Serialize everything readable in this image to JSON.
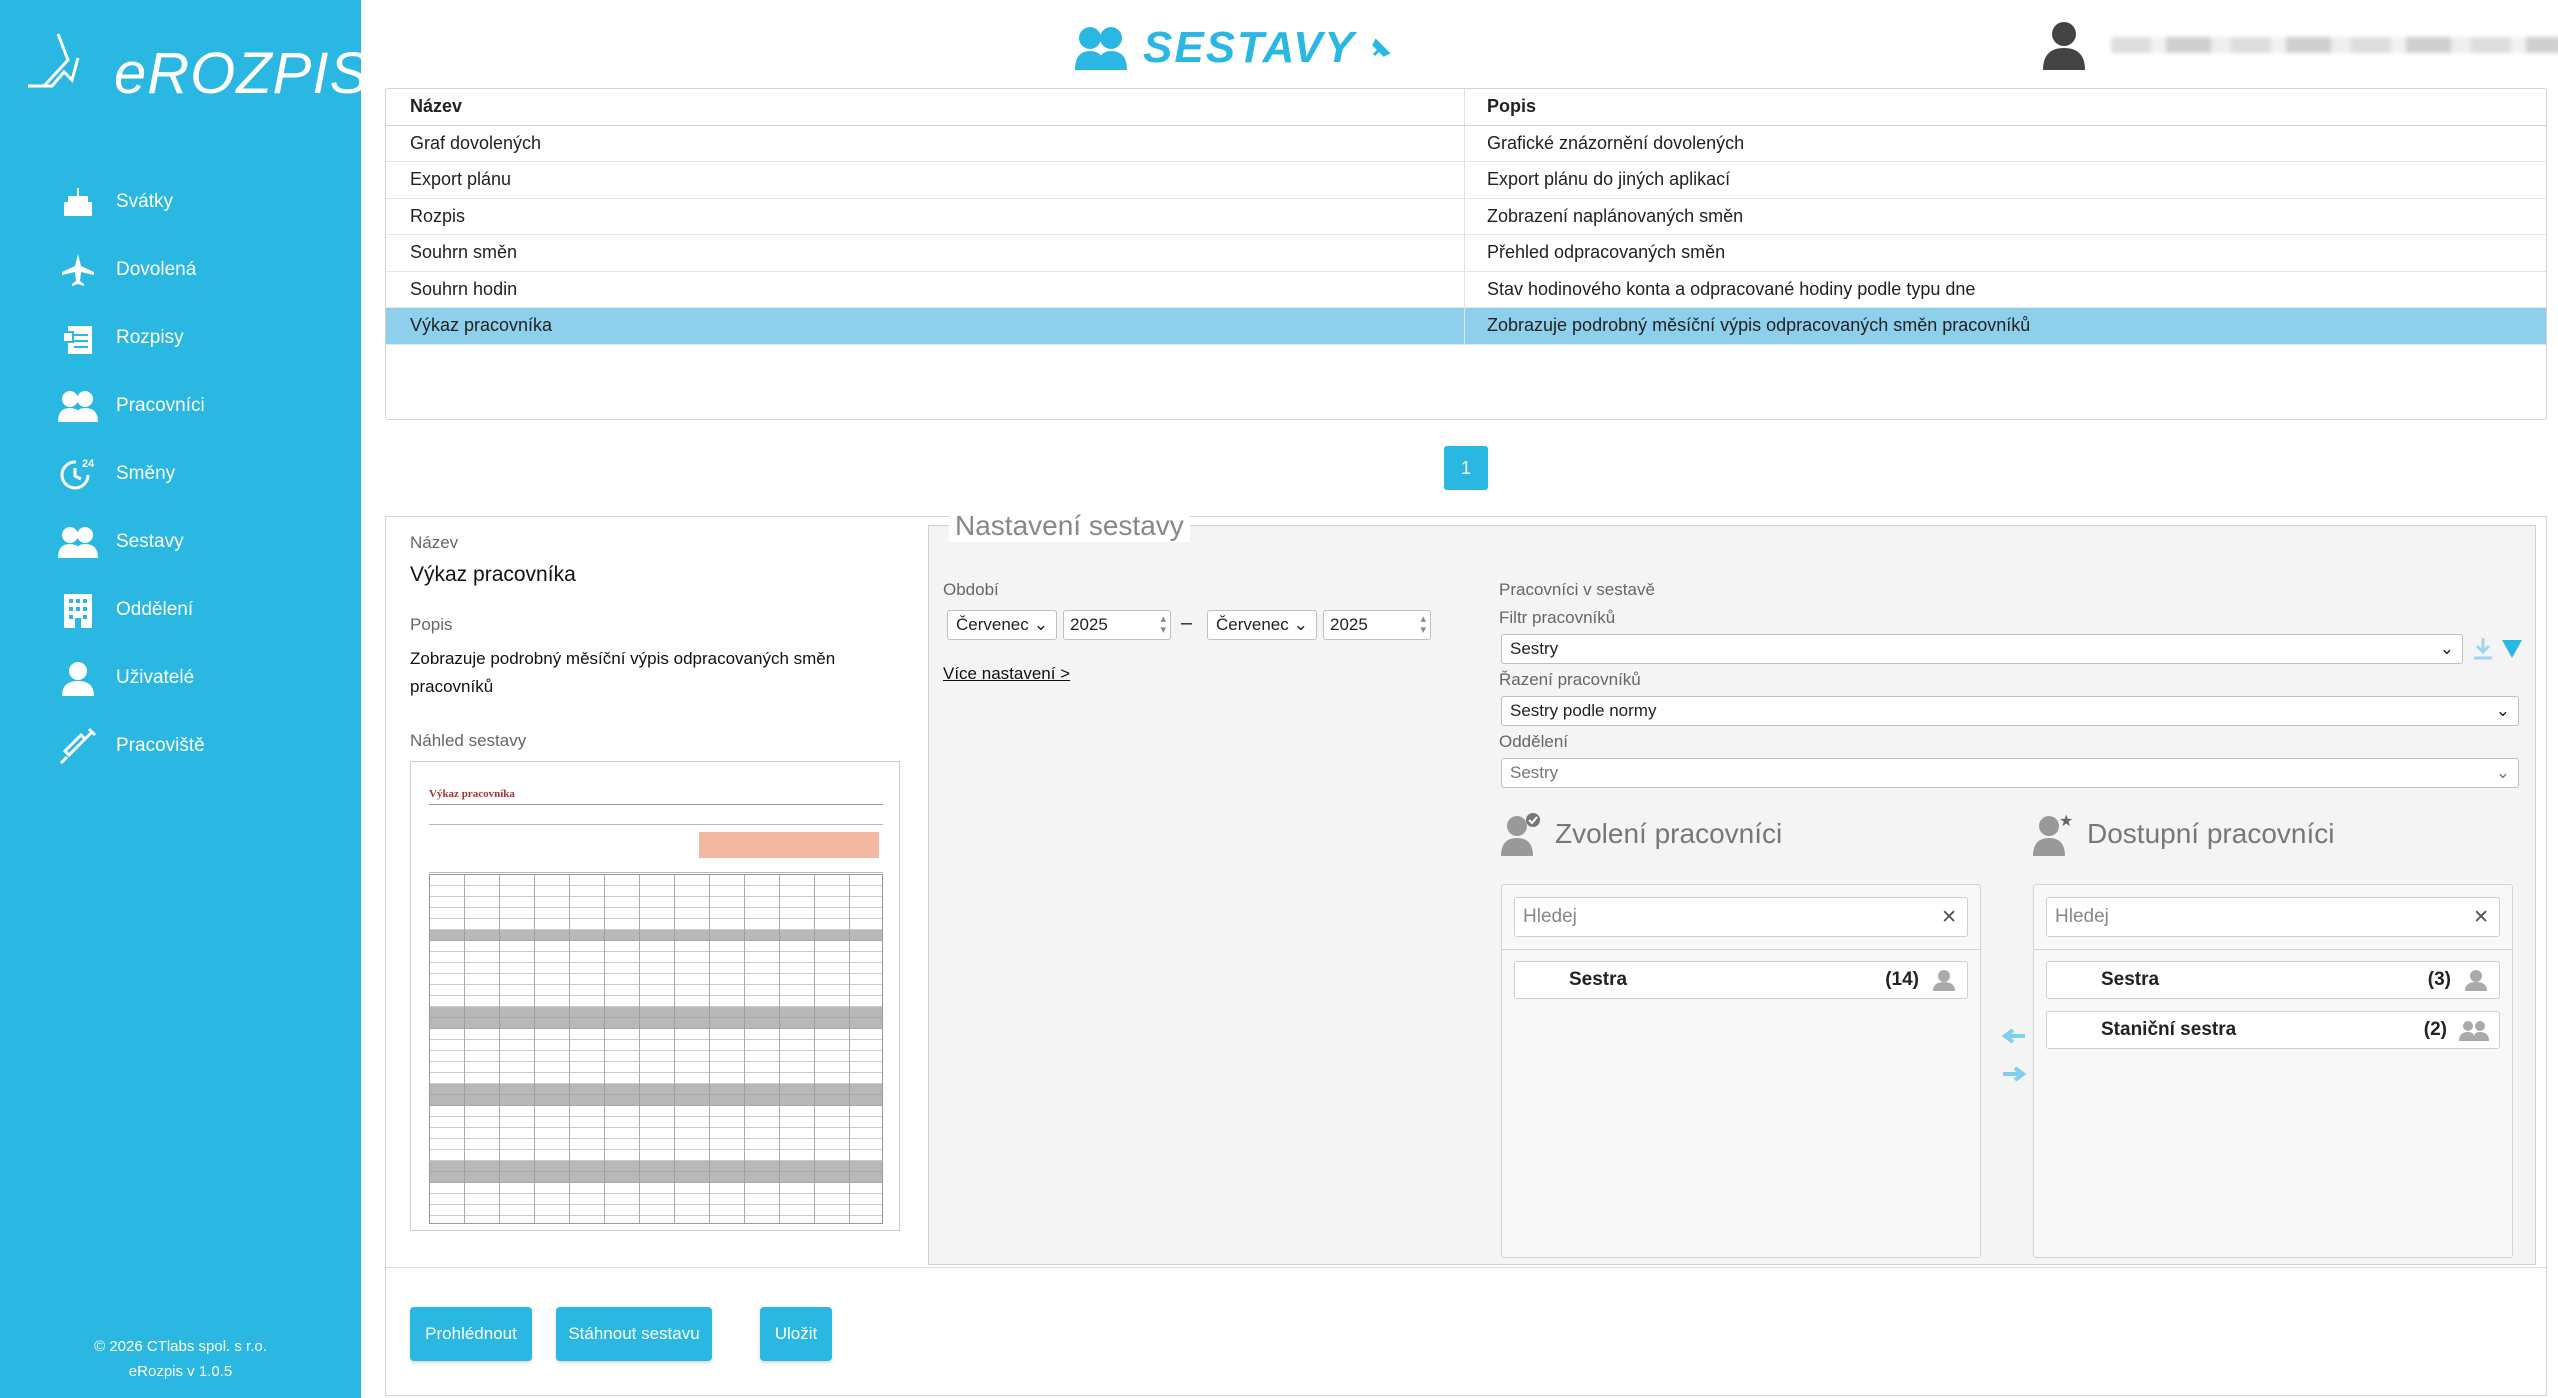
{
  "app": {
    "logo_text": "eROZPIS"
  },
  "sidebar": {
    "items": [
      {
        "label": "Svátky",
        "icon": "cake-icon"
      },
      {
        "label": "Dovolená",
        "icon": "airplane-icon"
      },
      {
        "label": "Rozpisy",
        "icon": "clipboard-icon"
      },
      {
        "label": "Pracovníci",
        "icon": "people-icon"
      },
      {
        "label": "Směny",
        "icon": "clock-24-icon"
      },
      {
        "label": "Sestavy",
        "icon": "people-report-icon"
      },
      {
        "label": "Oddělení",
        "icon": "building-icon"
      },
      {
        "label": "Uživatelé",
        "icon": "user-icon"
      },
      {
        "label": "Pracoviště",
        "icon": "syringe-icon"
      }
    ],
    "footer_copyright": "© 2026 CTlabs spol. s r.o.",
    "footer_version": "eRozpis v 1.0.5"
  },
  "header": {
    "title": "SESTAVY"
  },
  "reports": {
    "col_name": "Název",
    "col_desc": "Popis",
    "rows": [
      {
        "name": "Graf dovolených",
        "desc": "Grafické znázornění dovolených"
      },
      {
        "name": "Export plánu",
        "desc": "Export plánu do jiných aplikací"
      },
      {
        "name": "Rozpis",
        "desc": "Zobrazení naplánovaných směn"
      },
      {
        "name": "Souhrn směn",
        "desc": "Přehled odpracovaných směn"
      },
      {
        "name": "Souhrn hodin",
        "desc": "Stav hodinového konta a odpracované hodiny podle typu dne"
      },
      {
        "name": "Výkaz pracovníka",
        "desc": "Zobrazuje podrobný měsíční výpis odpracovaných směn pracovníků"
      }
    ],
    "selected_index": 5
  },
  "pager": {
    "page": "1"
  },
  "detail": {
    "name_label": "Název",
    "name_value": "Výkaz pracovníka",
    "desc_label": "Popis",
    "desc_value": "Zobrazuje podrobný měsíční výpis odpracovaných směn pracovníků",
    "preview_label": "Náhled sestavy",
    "preview_title": "Výkaz pracovníka"
  },
  "settings": {
    "legend": "Nastavení sestavy",
    "period_label": "Období",
    "from_month": "Červenec",
    "from_year": "2025",
    "dash": "–",
    "to_month": "Červenec",
    "to_year": "2025",
    "more_link": "Více nastavení >",
    "workers_in_report": "Pracovníci v sestavě",
    "filter_label": "Filtr pracovníků",
    "filter_value": "Sestry",
    "sort_label": "Řazení pracovníků",
    "sort_value": "Sestry podle normy",
    "dept_label": "Oddělení",
    "dept_value": "Sestry"
  },
  "selected_panel": {
    "title": "Zvolení pracovníci",
    "search_placeholder": "Hledej",
    "items": [
      {
        "label": "Sestra",
        "count": "(14)"
      }
    ]
  },
  "available_panel": {
    "title": "Dostupní pracovníci",
    "search_placeholder": "Hledej",
    "items": [
      {
        "label": "Sestra",
        "count": "(3)"
      },
      {
        "label": "Staniční sestra",
        "count": "(2)"
      }
    ]
  },
  "buttons": {
    "view": "Prohlédnout",
    "download": "Stáhnout sestavu",
    "save": "Uložit"
  },
  "colors": {
    "accent": "#2ab8e2",
    "selected_row": "#8ed0ec"
  }
}
